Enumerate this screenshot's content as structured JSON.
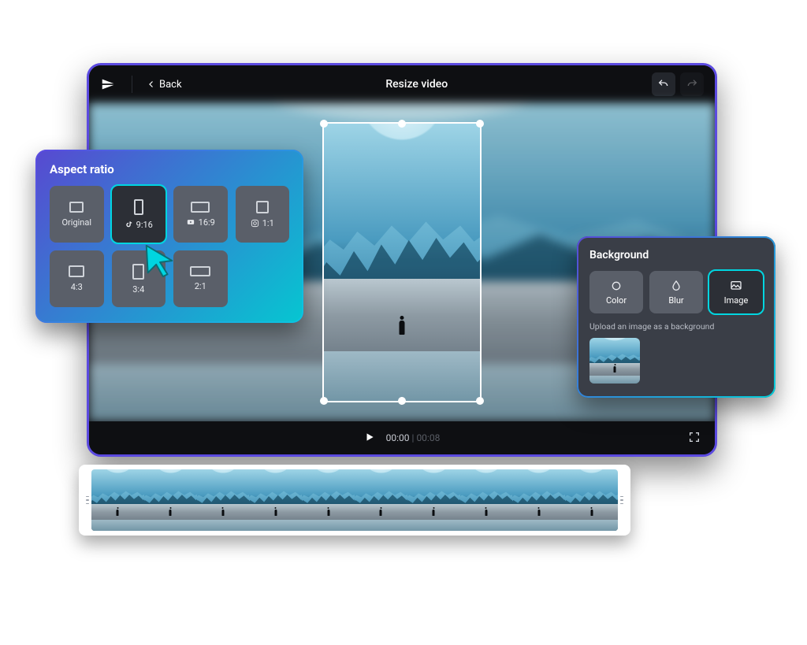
{
  "header": {
    "back_label": "Back",
    "title": "Resize video"
  },
  "playbar": {
    "current": "00:00",
    "duration": "00:08"
  },
  "aspect_panel": {
    "title": "Aspect ratio",
    "tiles": [
      {
        "label": "Original"
      },
      {
        "label": "9:16"
      },
      {
        "label": "16:9"
      },
      {
        "label": "1:1"
      },
      {
        "label": "4:3"
      },
      {
        "label": "3:4"
      },
      {
        "label": "2:1"
      }
    ],
    "selected_index": 1
  },
  "background_panel": {
    "title": "Background",
    "tabs": {
      "color": "Color",
      "blur": "Blur",
      "image": "Image"
    },
    "selected_tab": "image",
    "hint": "Upload an image as a background"
  },
  "icons": {
    "logo": "capcut-logo-icon",
    "back": "chevron-left-icon",
    "undo": "undo-icon",
    "redo": "redo-icon",
    "play": "play-icon",
    "fullscreen": "fullscreen-icon",
    "tiktok": "tiktok-icon",
    "youtube": "youtube-icon",
    "instagram": "instagram-icon",
    "color": "circle-icon",
    "blur": "droplet-icon",
    "image": "image-icon",
    "cursor": "cursor-icon"
  }
}
